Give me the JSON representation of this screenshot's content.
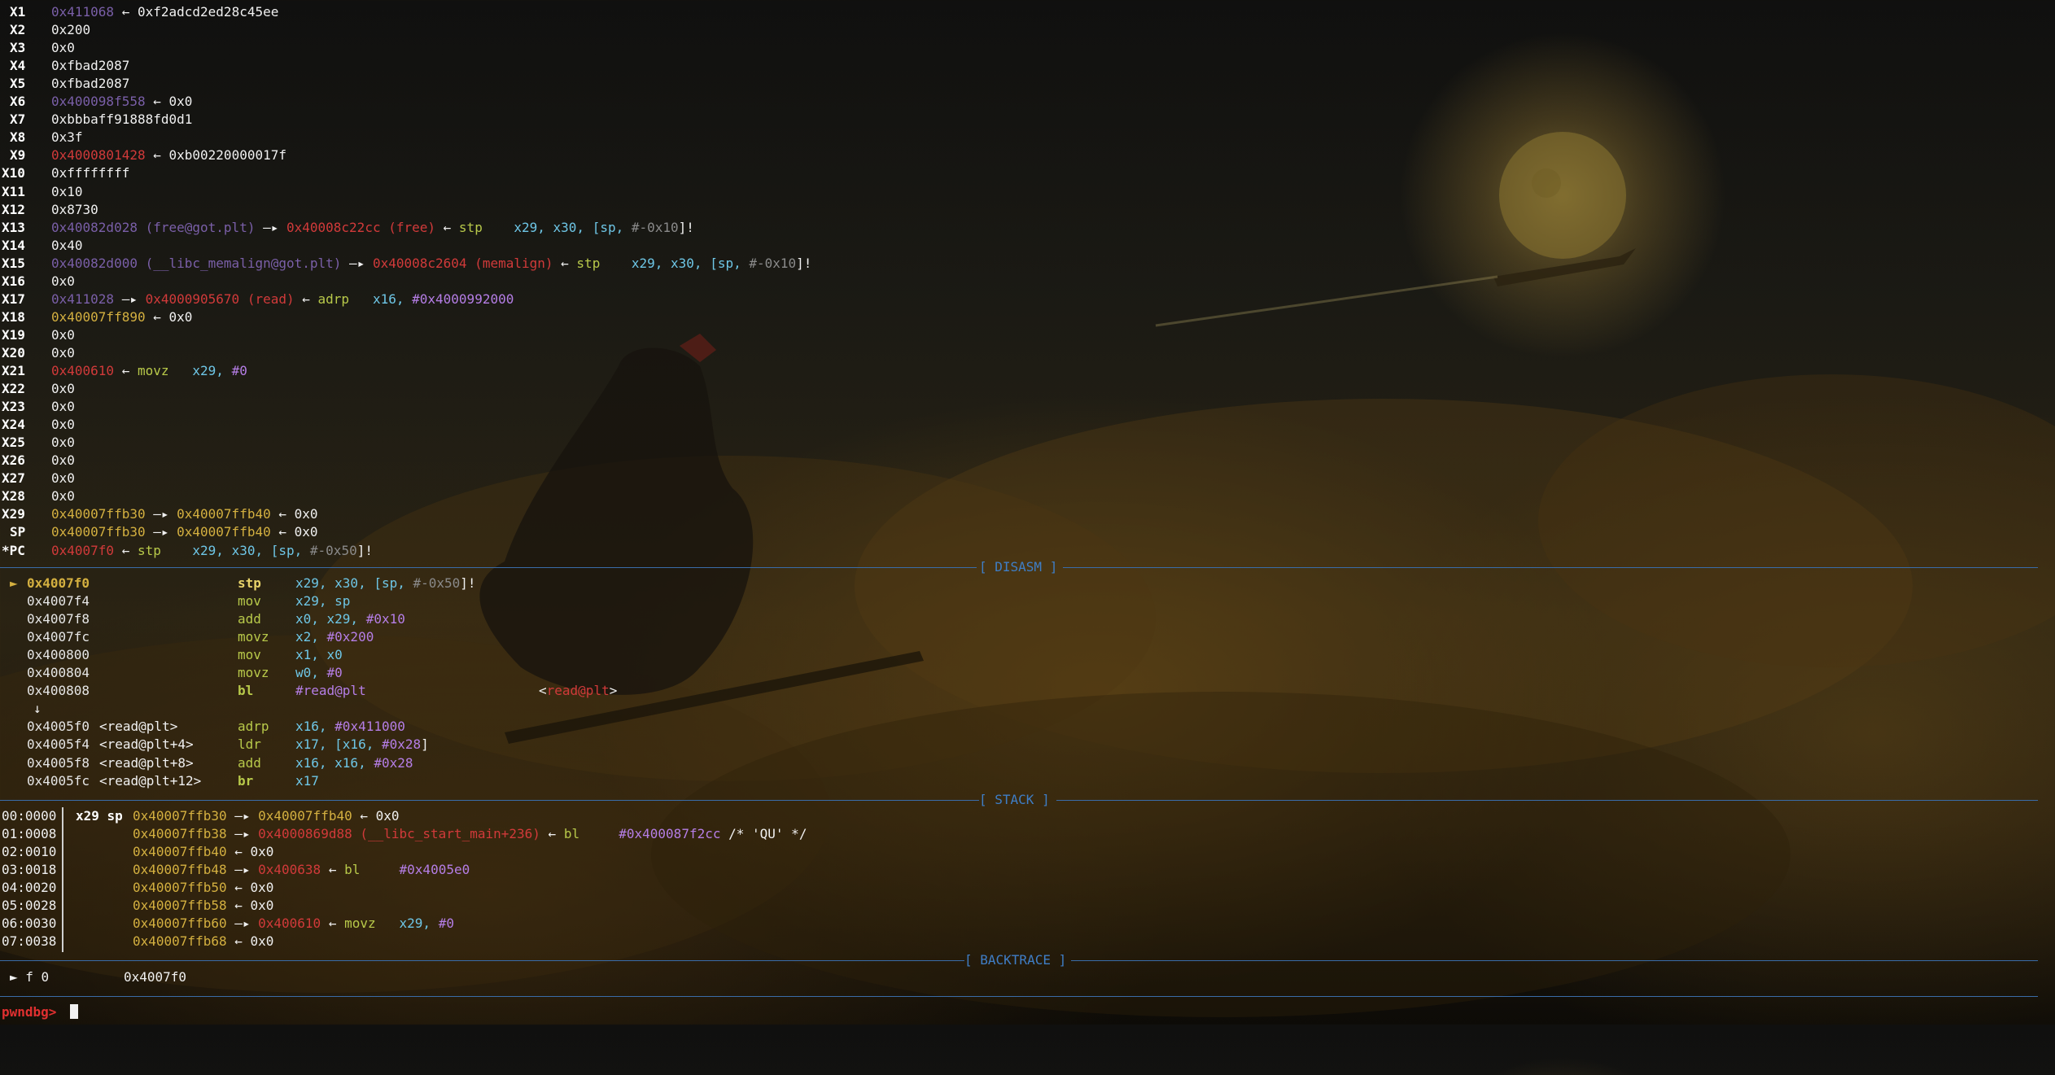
{
  "registers": [
    {
      "name": "X1",
      "parts": [
        {
          "t": "0x411068",
          "c": "dim"
        },
        {
          "t": " ← ",
          "c": "white"
        },
        {
          "t": "0xf2adcd2ed28c45ee",
          "c": "white"
        }
      ]
    },
    {
      "name": "X2",
      "parts": [
        {
          "t": "0x200",
          "c": "white"
        }
      ]
    },
    {
      "name": "X3",
      "parts": [
        {
          "t": "0x0",
          "c": "white"
        }
      ]
    },
    {
      "name": "X4",
      "parts": [
        {
          "t": "0xfbad2087",
          "c": "white"
        }
      ]
    },
    {
      "name": "X5",
      "parts": [
        {
          "t": "0xfbad2087",
          "c": "white"
        }
      ]
    },
    {
      "name": "X6",
      "parts": [
        {
          "t": "0x400098f558",
          "c": "dim"
        },
        {
          "t": " ← ",
          "c": "white"
        },
        {
          "t": "0x0",
          "c": "white"
        }
      ]
    },
    {
      "name": "X7",
      "parts": [
        {
          "t": "0xbbbaff91888fd0d1",
          "c": "white"
        }
      ]
    },
    {
      "name": "X8",
      "parts": [
        {
          "t": "0x3f",
          "c": "white"
        }
      ]
    },
    {
      "name": "X9",
      "parts": [
        {
          "t": "0x4000801428",
          "c": "code"
        },
        {
          "t": " ← ",
          "c": "white"
        },
        {
          "t": "0xb00220000017f",
          "c": "white"
        }
      ]
    },
    {
      "name": "X10",
      "parts": [
        {
          "t": "0xffffffff",
          "c": "white"
        }
      ]
    },
    {
      "name": "X11",
      "parts": [
        {
          "t": "0x10",
          "c": "white"
        }
      ]
    },
    {
      "name": "X12",
      "parts": [
        {
          "t": "0x8730",
          "c": "white"
        }
      ]
    },
    {
      "name": "X13",
      "parts": [
        {
          "t": "0x40082d028 (free@got.plt)",
          "c": "dim"
        },
        {
          "t": " —▸ ",
          "c": "white"
        },
        {
          "t": "0x40008c22cc (free)",
          "c": "code"
        },
        {
          "t": " ← ",
          "c": "white"
        },
        {
          "t": "stp",
          "c": "ins"
        },
        {
          "t": "    x29, x30, [sp, ",
          "c": "opr"
        },
        {
          "t": "#-0x10",
          "c": "gray"
        },
        {
          "t": "]!",
          "c": "white"
        }
      ]
    },
    {
      "name": "X14",
      "parts": [
        {
          "t": "0x40",
          "c": "white"
        }
      ]
    },
    {
      "name": "X15",
      "parts": [
        {
          "t": "0x40082d000 (__libc_memalign@got.plt)",
          "c": "dim"
        },
        {
          "t": " —▸ ",
          "c": "white"
        },
        {
          "t": "0x40008c2604 (memalign)",
          "c": "code"
        },
        {
          "t": " ← ",
          "c": "white"
        },
        {
          "t": "stp",
          "c": "ins"
        },
        {
          "t": "    x29, x30, [sp, ",
          "c": "opr"
        },
        {
          "t": "#-0x10",
          "c": "gray"
        },
        {
          "t": "]!",
          "c": "white"
        }
      ]
    },
    {
      "name": "X16",
      "parts": [
        {
          "t": "0x0",
          "c": "white"
        }
      ]
    },
    {
      "name": "X17",
      "parts": [
        {
          "t": "0x411028",
          "c": "dim"
        },
        {
          "t": " —▸ ",
          "c": "white"
        },
        {
          "t": "0x4000905670 (read)",
          "c": "code"
        },
        {
          "t": " ← ",
          "c": "white"
        },
        {
          "t": "adrp",
          "c": "ins"
        },
        {
          "t": "   x16, ",
          "c": "opr"
        },
        {
          "t": "#0x4000992000",
          "c": "num"
        }
      ]
    },
    {
      "name": "X18",
      "parts": [
        {
          "t": "0x40007ff890",
          "c": "stack"
        },
        {
          "t": " ← ",
          "c": "white"
        },
        {
          "t": "0x0",
          "c": "white"
        }
      ]
    },
    {
      "name": "X19",
      "parts": [
        {
          "t": "0x0",
          "c": "white"
        }
      ]
    },
    {
      "name": "X20",
      "parts": [
        {
          "t": "0x0",
          "c": "white"
        }
      ]
    },
    {
      "name": "X21",
      "parts": [
        {
          "t": "0x400610",
          "c": "code"
        },
        {
          "t": " ← ",
          "c": "white"
        },
        {
          "t": "movz",
          "c": "ins"
        },
        {
          "t": "   x29, ",
          "c": "opr"
        },
        {
          "t": "#0",
          "c": "num"
        }
      ]
    },
    {
      "name": "X22",
      "parts": [
        {
          "t": "0x0",
          "c": "white"
        }
      ]
    },
    {
      "name": "X23",
      "parts": [
        {
          "t": "0x0",
          "c": "white"
        }
      ]
    },
    {
      "name": "X24",
      "parts": [
        {
          "t": "0x0",
          "c": "white"
        }
      ]
    },
    {
      "name": "X25",
      "parts": [
        {
          "t": "0x0",
          "c": "white"
        }
      ]
    },
    {
      "name": "X26",
      "parts": [
        {
          "t": "0x0",
          "c": "white"
        }
      ]
    },
    {
      "name": "X27",
      "parts": [
        {
          "t": "0x0",
          "c": "white"
        }
      ]
    },
    {
      "name": "X28",
      "parts": [
        {
          "t": "0x0",
          "c": "white"
        }
      ]
    },
    {
      "name": "X29",
      "parts": [
        {
          "t": "0x40007ffb30",
          "c": "stack"
        },
        {
          "t": " —▸ ",
          "c": "white"
        },
        {
          "t": "0x40007ffb40",
          "c": "stack"
        },
        {
          "t": " ← ",
          "c": "white"
        },
        {
          "t": "0x0",
          "c": "white"
        }
      ]
    },
    {
      "name": "SP",
      "parts": [
        {
          "t": "0x40007ffb30",
          "c": "stack"
        },
        {
          "t": " —▸ ",
          "c": "white"
        },
        {
          "t": "0x40007ffb40",
          "c": "stack"
        },
        {
          "t": " ← ",
          "c": "white"
        },
        {
          "t": "0x0",
          "c": "white"
        }
      ]
    },
    {
      "name": "*PC",
      "parts": [
        {
          "t": "0x4007f0",
          "c": "code"
        },
        {
          "t": " ← ",
          "c": "white"
        },
        {
          "t": "stp",
          "c": "ins"
        },
        {
          "t": "    x29, x30, [sp, ",
          "c": "opr"
        },
        {
          "t": "#-0x50",
          "c": "gray"
        },
        {
          "t": "]!",
          "c": "white"
        }
      ]
    }
  ],
  "sections": {
    "disasm": "[ DISASM ]",
    "stack": "[ STACK ]",
    "backtrace": "[ BACKTRACE ]"
  },
  "disasm": [
    {
      "marker": "►",
      "addr": "0x4007f0",
      "sym": "",
      "mn": "stp",
      "ops": [
        {
          "t": "x29, x30, [sp, ",
          "c": "opr"
        },
        {
          "t": "#-0x50",
          "c": "gray"
        },
        {
          "t": "]!",
          "c": "white"
        }
      ],
      "current": true,
      "comment": []
    },
    {
      "marker": "",
      "addr": "0x4007f4",
      "sym": "",
      "mn": "mov",
      "ops": [
        {
          "t": "x29, sp",
          "c": "opr"
        }
      ],
      "current": false,
      "comment": []
    },
    {
      "marker": "",
      "addr": "0x4007f8",
      "sym": "",
      "mn": "add",
      "ops": [
        {
          "t": "x0, x29, ",
          "c": "opr"
        },
        {
          "t": "#0x10",
          "c": "num"
        }
      ],
      "current": false,
      "comment": []
    },
    {
      "marker": "",
      "addr": "0x4007fc",
      "sym": "",
      "mn": "movz",
      "ops": [
        {
          "t": "x2, ",
          "c": "opr"
        },
        {
          "t": "#0x200",
          "c": "num"
        }
      ],
      "current": false,
      "comment": []
    },
    {
      "marker": "",
      "addr": "0x400800",
      "sym": "",
      "mn": "mov",
      "ops": [
        {
          "t": "x1, x0",
          "c": "opr"
        }
      ],
      "current": false,
      "comment": []
    },
    {
      "marker": "",
      "addr": "0x400804",
      "sym": "",
      "mn": "movz",
      "ops": [
        {
          "t": "w0, ",
          "c": "opr"
        },
        {
          "t": "#0",
          "c": "num"
        }
      ],
      "current": false,
      "comment": []
    },
    {
      "marker": "",
      "addr": "0x400808",
      "sym": "",
      "mn": "bl",
      "ops": [
        {
          "t": "#read@plt",
          "c": "num"
        }
      ],
      "current": false,
      "bold": true,
      "comment": [
        {
          "t": "<",
          "c": "white"
        },
        {
          "t": "read@plt",
          "c": "code"
        },
        {
          "t": ">",
          "c": "white"
        }
      ]
    },
    {
      "marker": "↓",
      "addr": "",
      "sym": "",
      "mn": "",
      "ops": [],
      "current": false,
      "comment": [],
      "downarrow": true
    },
    {
      "marker": "",
      "addr": "0x4005f0",
      "sym": "<read@plt>",
      "mn": "adrp",
      "ops": [
        {
          "t": "x16, ",
          "c": "opr"
        },
        {
          "t": "#0x411000",
          "c": "num"
        }
      ],
      "current": false,
      "comment": []
    },
    {
      "marker": "",
      "addr": "0x4005f4",
      "sym": "<read@plt+4>",
      "mn": "ldr",
      "ops": [
        {
          "t": "x17, [x16, ",
          "c": "opr"
        },
        {
          "t": "#0x28",
          "c": "num"
        },
        {
          "t": "]",
          "c": "white"
        }
      ],
      "current": false,
      "comment": []
    },
    {
      "marker": "",
      "addr": "0x4005f8",
      "sym": "<read@plt+8>",
      "mn": "add",
      "ops": [
        {
          "t": "x16, x16, ",
          "c": "opr"
        },
        {
          "t": "#0x28",
          "c": "num"
        }
      ],
      "current": false,
      "comment": []
    },
    {
      "marker": "",
      "addr": "0x4005fc",
      "sym": "<read@plt+12>",
      "mn": "br",
      "ops": [
        {
          "t": "x17",
          "c": "opr"
        }
      ],
      "current": false,
      "bold": true,
      "comment": []
    }
  ],
  "stack": [
    {
      "off": "00:0000",
      "regs": "x29 sp",
      "parts": [
        {
          "t": "0x40007ffb30",
          "c": "stack"
        },
        {
          "t": " —▸ ",
          "c": "white"
        },
        {
          "t": "0x40007ffb40",
          "c": "stack"
        },
        {
          "t": " ← ",
          "c": "white"
        },
        {
          "t": "0x0",
          "c": "white"
        }
      ]
    },
    {
      "off": "01:0008",
      "regs": "",
      "parts": [
        {
          "t": "0x40007ffb38",
          "c": "stack"
        },
        {
          "t": " —▸ ",
          "c": "white"
        },
        {
          "t": "0x4000869d88 (__libc_start_main+236)",
          "c": "code"
        },
        {
          "t": " ← ",
          "c": "white"
        },
        {
          "t": "bl",
          "c": "ins"
        },
        {
          "t": "     ",
          "c": "white"
        },
        {
          "t": "#0x400087f2cc",
          "c": "num"
        },
        {
          "t": " /* 'QU' */",
          "c": "white"
        }
      ]
    },
    {
      "off": "02:0010",
      "regs": "",
      "parts": [
        {
          "t": "0x40007ffb40",
          "c": "stack"
        },
        {
          "t": " ← ",
          "c": "white"
        },
        {
          "t": "0x0",
          "c": "white"
        }
      ]
    },
    {
      "off": "03:0018",
      "regs": "",
      "parts": [
        {
          "t": "0x40007ffb48",
          "c": "stack"
        },
        {
          "t": " —▸ ",
          "c": "white"
        },
        {
          "t": "0x400638",
          "c": "code"
        },
        {
          "t": " ← ",
          "c": "white"
        },
        {
          "t": "bl",
          "c": "ins"
        },
        {
          "t": "     ",
          "c": "white"
        },
        {
          "t": "#0x4005e0",
          "c": "num"
        }
      ]
    },
    {
      "off": "04:0020",
      "regs": "",
      "parts": [
        {
          "t": "0x40007ffb50",
          "c": "stack"
        },
        {
          "t": " ← ",
          "c": "white"
        },
        {
          "t": "0x0",
          "c": "white"
        }
      ]
    },
    {
      "off": "05:0028",
      "regs": "",
      "parts": [
        {
          "t": "0x40007ffb58",
          "c": "stack"
        },
        {
          "t": " ← ",
          "c": "white"
        },
        {
          "t": "0x0",
          "c": "white"
        }
      ]
    },
    {
      "off": "06:0030",
      "regs": "",
      "parts": [
        {
          "t": "0x40007ffb60",
          "c": "stack"
        },
        {
          "t": " —▸ ",
          "c": "white"
        },
        {
          "t": "0x400610",
          "c": "code"
        },
        {
          "t": " ← ",
          "c": "white"
        },
        {
          "t": "movz",
          "c": "ins"
        },
        {
          "t": "   x29, ",
          "c": "opr"
        },
        {
          "t": "#0",
          "c": "num"
        }
      ]
    },
    {
      "off": "07:0038",
      "regs": "",
      "parts": [
        {
          "t": "0x40007ffb68",
          "c": "stack"
        },
        {
          "t": " ← ",
          "c": "white"
        },
        {
          "t": "0x0",
          "c": "white"
        }
      ]
    }
  ],
  "backtrace": [
    {
      "marker": "► f 0",
      "addr": "0x4007f0"
    }
  ],
  "prompt": "pwndbg> ",
  "colors": {
    "separator": "#3a6ca8",
    "prompt": "#e03030",
    "code": "#d13a3a",
    "stack": "#d4b040",
    "heap": "#7a5fa8"
  }
}
